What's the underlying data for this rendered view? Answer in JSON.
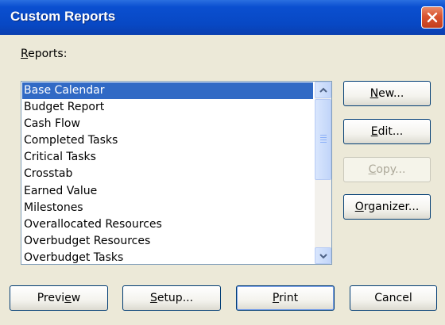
{
  "window": {
    "title": "Custom Reports"
  },
  "reports": {
    "label": "Reports:",
    "items": [
      "Base Calendar",
      "Budget Report",
      "Cash Flow",
      "Completed Tasks",
      "Critical Tasks",
      "Crosstab",
      "Earned Value",
      "Milestones",
      "Overallocated Resources",
      "Overbudget Resources",
      "Overbudget Tasks"
    ],
    "selected": "Base Calendar"
  },
  "side_buttons": {
    "new": "New...",
    "edit": "Edit...",
    "copy": "Copy...",
    "organizer": "Organizer..."
  },
  "bottom_buttons": {
    "preview": "Preview",
    "setup": "Setup...",
    "print": "Print",
    "cancel": "Cancel"
  }
}
